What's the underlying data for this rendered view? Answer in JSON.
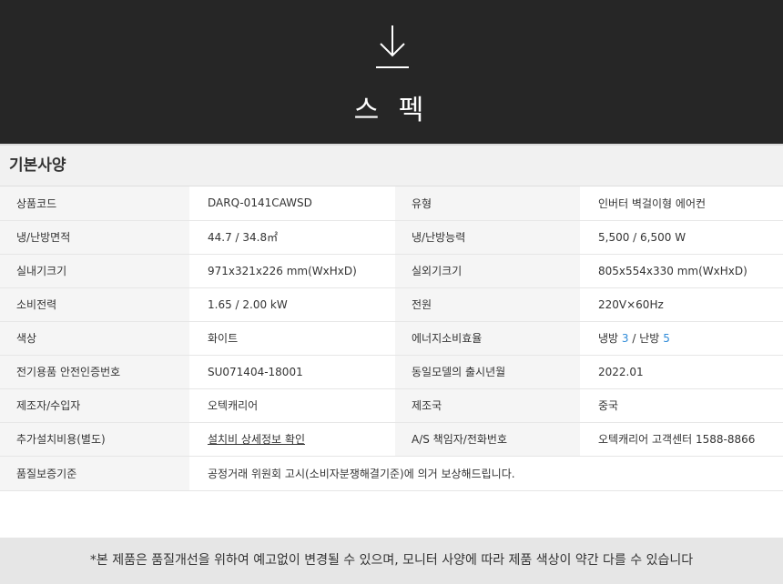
{
  "hero": {
    "title": "스 펙",
    "icon": "download-arrow-icon"
  },
  "section": {
    "title": "기본사양"
  },
  "specs": {
    "r1": {
      "l1": "상품코드",
      "v1": "DARQ-0141CAWSD",
      "l2": "유형",
      "v2": "인버터 벽걸이형 에어컨"
    },
    "r2": {
      "l1": "냉/난방면적",
      "v1": "44.7 / 34.8㎡",
      "l2": "냉/난방능력",
      "v2": "5,500 / 6,500 W"
    },
    "r3": {
      "l1": "실내기크기",
      "v1": "971x321x226 mm(WxHxD)",
      "l2": "실외기크기",
      "v2": "805x554x330 mm(WxHxD)"
    },
    "r4": {
      "l1": "소비전력",
      "v1": "1.65 / 2.00 kW",
      "l2": "전원",
      "v2": "220V×60Hz"
    },
    "r5": {
      "l1": "색상",
      "v1": "화이트",
      "l2": "에너지소비효율",
      "v2_cool": "냉방",
      "v2_cool_grade": "3",
      "v2_sep": "/",
      "v2_heat": "난방",
      "v2_heat_grade": "5"
    },
    "r6": {
      "l1": "전기용품 안전인증번호",
      "v1": "SU071404-18001",
      "l2": "동일모델의 출시년월",
      "v2": "2022.01"
    },
    "r7": {
      "l1": "제조자/수입자",
      "v1": "오텍캐리어",
      "l2": "제조국",
      "v2": "중국"
    },
    "r8": {
      "l1": "추가설치비용(별도)",
      "v1": "설치비 상세정보 확인",
      "l2": "A/S 책임자/전화번호",
      "v2": "오텍캐리어 고객센터 1588-8866"
    },
    "r9": {
      "l1": "품질보증기준",
      "v1": "공정거래 위원회 고시(소비자분쟁해결기준)에 의거 보상해드립니다."
    }
  },
  "footer": {
    "notice": "*본 제품은 품질개선을 위하여 예고없이 변경될 수 있으며, 모니터 사양에 따라 제품 색상이 약간 다를 수 있습니다"
  }
}
